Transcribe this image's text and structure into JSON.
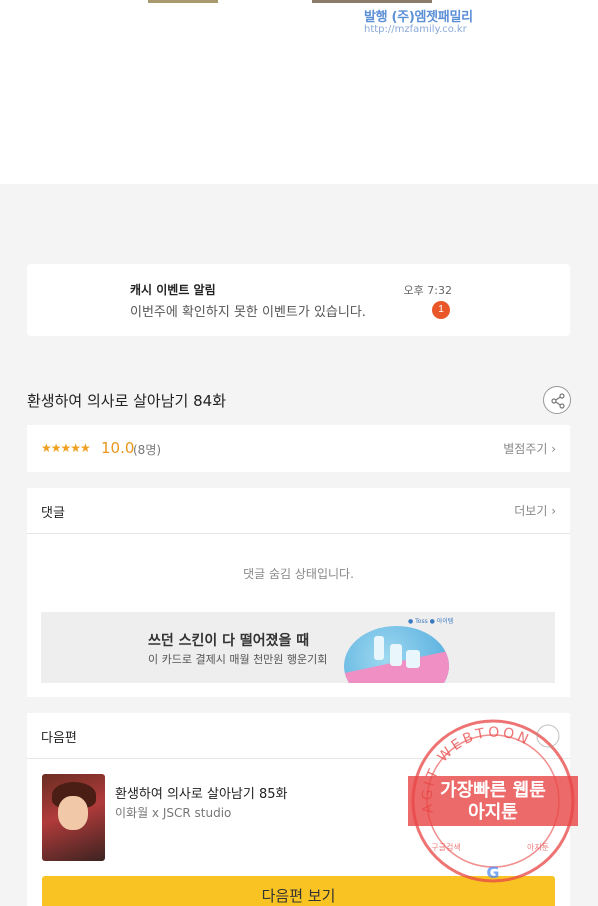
{
  "comic_credit": {
    "publisher": "발행 (주)엠젯패밀리",
    "url": "http://mzfamily.co.kr"
  },
  "notification": {
    "title": "캐시 이벤트 알림",
    "message": "이번주에 확인하지 못한 이벤트가 있습니다.",
    "time": "오후 7:32",
    "badge": "1"
  },
  "episode": {
    "title": "환생하여 의사로 살아남기 84화",
    "share_icon": "share-icon"
  },
  "rating": {
    "stars": "★★★★★",
    "score": "10.0",
    "count": "(8명)",
    "rate_link": "별점주기 ›"
  },
  "comments": {
    "header": "댓글",
    "more_link": "더보기 ›",
    "hidden_message": "댓글 숨김 상태입니다."
  },
  "ad": {
    "title": "쓰던 스킨이 다 떨어졌을 때",
    "subtitle": "이 카드로 결제시 매월 천만원 행운기회",
    "logos": "● Toss ● 아이템"
  },
  "next": {
    "header": "다음편",
    "episode_title": "환생하여 의사로 살아남기 85화",
    "authors": "이화월 x JSCR studio",
    "button_label": "다음편 보기"
  },
  "watermark": {
    "arc_text": "AGIT WEBTOON",
    "line1": "가장빠른 웹툰",
    "line2": "아지툰",
    "small_left": "구글검색",
    "small_right": "아지툰"
  },
  "colors": {
    "accent_yellow": "#f8c323",
    "badge_orange": "#e8562a",
    "star_orange": "#f0a020",
    "watermark_red": "#e84545"
  }
}
